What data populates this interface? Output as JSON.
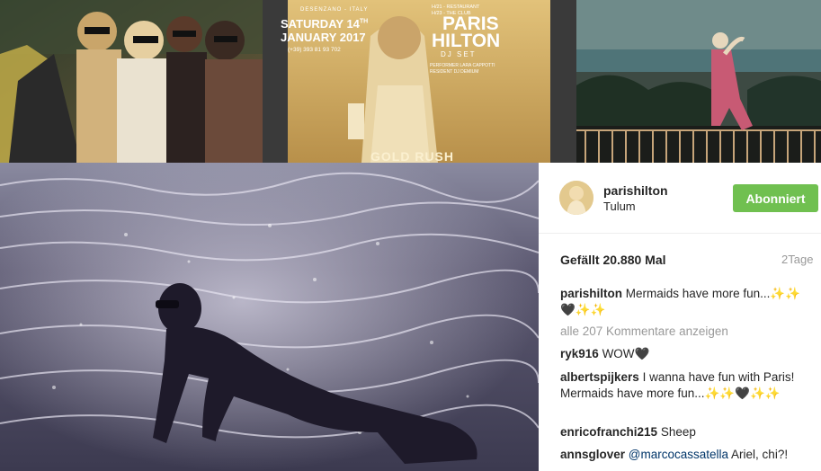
{
  "grid": {
    "poster": {
      "line1": "DESENZANO - ITALY",
      "date1": "SATURDAY 14",
      "date_sup": "TH",
      "date2": "JANUARY 2017",
      "phone": "(+39) 393 81 93 702",
      "right_top": "H/21 - RESTAURANT\nH/23 - THE CLUB",
      "title1": "PARIS",
      "title2": "HILTON",
      "subtitle": "DJ SET",
      "credit1": "PERFORMER LARA CAPPOTTI",
      "credit2": "RESIDENT DJ DEMIUM",
      "footer": "GOLD RUSH"
    }
  },
  "post": {
    "username": "parishilton",
    "location": "Tulum",
    "follow_label": "Abonniert",
    "likes": "Gefällt 20.880 Mal",
    "age": "2Tage",
    "caption": {
      "user": "parishilton",
      "text": "Mermaids have more fun...✨✨🖤✨✨"
    },
    "view_all": "alle 207 Kommentare anzeigen",
    "comments": [
      {
        "user": "ryk916",
        "text": "WOW🖤",
        "mention": ""
      },
      {
        "user": "albertspijkers",
        "text": "I wanna have fun with Paris! Mermaids have more fun...✨✨🖤✨✨",
        "mention": ""
      },
      {
        "user": "enricofranchi215",
        "text": "Sheep",
        "mention": ""
      },
      {
        "user": "annsglover",
        "mention": "@marcocassatella",
        "text": " Ariel, chi?!"
      }
    ]
  },
  "colors": {
    "follow_button": "#70c050",
    "muted_text": "#999999",
    "mention": "#003569"
  }
}
